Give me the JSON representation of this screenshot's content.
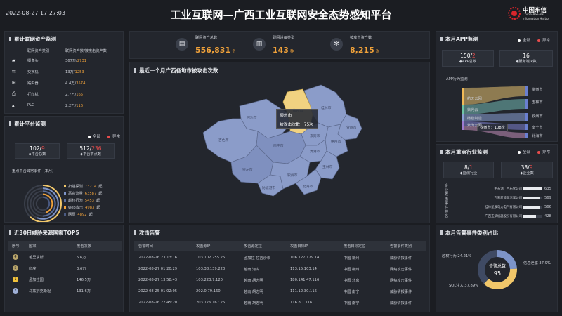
{
  "header": {
    "datetime": "2022-08-27 17:27:03",
    "title": "工业互联网—广西工业互联网安全态势感知平台",
    "logo_cn": "中国东信",
    "logo_en1": "China-ASEAN",
    "logo_en2": "Information Harbor"
  },
  "assets": {
    "title": "累计联网资产监测",
    "col1": "联网资产类别",
    "col2": "联网资产数/被攻击资产数",
    "rows": [
      {
        "icon": "camera-icon",
        "name": "摄像头",
        "total": "367万",
        "attacked": "2731"
      },
      {
        "icon": "switch-icon",
        "name": "交换机",
        "total": "13万",
        "attacked": "1253"
      },
      {
        "icon": "router-icon",
        "name": "路由器",
        "total": "4.4万",
        "attacked": "3574"
      },
      {
        "icon": "printer-icon",
        "name": "打印机",
        "total": "2.7万",
        "attacked": "165"
      },
      {
        "icon": "plc-icon",
        "name": "PLC",
        "total": "2.2万",
        "attacked": "116"
      }
    ]
  },
  "platform": {
    "title": "累计平台监测",
    "legend_all": "全部",
    "legend_abn": "异常",
    "box1": {
      "value": "102",
      "abn": "9",
      "label": "平台总数"
    },
    "box2": {
      "value": "512",
      "abn": "236",
      "label": "平台节点数"
    },
    "sub": "重点平台异常事件（本月）",
    "events": [
      {
        "name": "扫描探测",
        "value": "73214",
        "unit": "起"
      },
      {
        "name": "恶意流量",
        "value": "63587",
        "unit": "起"
      },
      {
        "name": "越权行为",
        "value": "5453",
        "unit": "起"
      },
      {
        "name": "web攻击",
        "value": "4983",
        "unit": "起"
      },
      {
        "name": "网页",
        "value": "4892",
        "unit": "起"
      }
    ]
  },
  "threat": {
    "title": "近30日威胁来源国家TOP5",
    "cols": [
      "序号",
      "国家",
      "攻击次数"
    ],
    "rows": [
      {
        "rank": "4",
        "country": "毛里求斯",
        "count": "5.6万"
      },
      {
        "rank": "5",
        "country": "印度",
        "count": "3.6万"
      },
      {
        "rank": "1",
        "country": "孟加拉国",
        "count": "146.5万"
      },
      {
        "rank": "2",
        "country": "乌兹别克斯坦",
        "count": "131.6万"
      }
    ]
  },
  "stats": [
    {
      "icon": "asset-icon",
      "label": "联网资产总数",
      "value": "556,831",
      "unit": "个"
    },
    {
      "icon": "device-icon",
      "label": "联网设备类型",
      "value": "143",
      "unit": "种"
    },
    {
      "icon": "attacked-icon",
      "label": "被攻击资产数",
      "value": "8,215",
      "unit": "次"
    }
  ],
  "map": {
    "title": "最近一个月广西各地市被攻击次数",
    "tooltip_city": "柳州市",
    "tooltip_label": "被攻击次数：",
    "tooltip_value": "75次",
    "cities": [
      "河池市",
      "桂林市",
      "贺州市",
      "柳州市",
      "来宾市",
      "梧州市",
      "百色市",
      "南宁市",
      "贵港市",
      "玉林市",
      "崇左市",
      "防城港市",
      "钦州市",
      "北海市"
    ]
  },
  "attack": {
    "title": "攻击告警",
    "cols": [
      "告警时间",
      "攻击源IP",
      "攻击源定位",
      "攻击目标IP",
      "攻击目标定位",
      "告警事件类别"
    ],
    "rows": [
      [
        "2022-08-26 23:13:16",
        "103.102.255.25",
        "孟加拉 拉吉沙希",
        "106.127.179.14",
        "中国 柳州",
        "威胁情报事件"
      ],
      [
        "2022-08-27 01:20:29",
        "103.38.139.220",
        "越南 河内",
        "113.15.103.14",
        "中国 柳州",
        "网络攻击事件"
      ],
      [
        "2022-08-27 13:58:43",
        "103.223.7.120",
        "越南 胡志明",
        "180.141.47.116",
        "中国 北京",
        "网络攻击事件"
      ],
      [
        "2022-08-25 01:02:05",
        "202.0.79.160",
        "越南 胡志明",
        "111.12.30.116",
        "中国 南宁",
        "威胁情报事件"
      ],
      [
        "2022-08-26 22:45:20",
        "203.176.167.25",
        "越南 胡志明",
        "116.8.1.116",
        "中国 南宁",
        "威胁情报事件"
      ]
    ]
  },
  "app": {
    "title": "本月APP监测",
    "legend_all": "全部",
    "legend_abn": "异常",
    "box1": {
      "value": "150",
      "abn": "2",
      "label": "APP总数"
    },
    "box2": {
      "value": "16",
      "label": "服务端IP数"
    },
    "sub": "APP行为监测",
    "left": [
      "航天云网",
      "紫光云",
      "橄榄制造",
      "紫为云网"
    ],
    "right": [
      "柳州市",
      "玉林市",
      "钦州市",
      "南宁市",
      "北海市"
    ],
    "tooltip": "钦州市：108次"
  },
  "platform2": {
    "title": "本月重点行业监测",
    "legend_all": "全部",
    "legend_abn": "异常",
    "box1": {
      "value": "8",
      "abn": "1",
      "label": "监测行业"
    },
    "box2": {
      "value": "38",
      "abn": "9",
      "label": "企业数"
    },
    "side": "企业攻击事件排名",
    "rows": [
      {
        "name": "中石油广西石化公司",
        "value": 635,
        "label": "635"
      },
      {
        "name": "吉利新能源汽车公司",
        "value": 569,
        "label": "569"
      },
      {
        "name": "桂林星辰电力电气有限公司",
        "value": 566,
        "label": "566"
      },
      {
        "name": "广西玉柴机器股份有限公司",
        "value": 428,
        "label": "428"
      }
    ]
  },
  "alarm": {
    "title": "本月告警事件类别占比",
    "center_label": "告警总数",
    "center_value": "95",
    "slices": [
      {
        "name": "越权行为",
        "pct": 24.21,
        "label": "越权行为  24.21%",
        "color": "#7d94c8"
      },
      {
        "name": "信息泄露",
        "pct": 37.9,
        "label": "信息泄露  37.9%",
        "color": "#f1c76a"
      },
      {
        "name": "SQL注入",
        "pct": 37.89,
        "label": "SQL注入  37.89%",
        "color": "#3f4a63"
      }
    ]
  },
  "colors": {
    "orange": "#f1a23a",
    "red": "#e84c4c",
    "map": "#8b9cc9",
    "map_highlight": "#f1d281"
  }
}
